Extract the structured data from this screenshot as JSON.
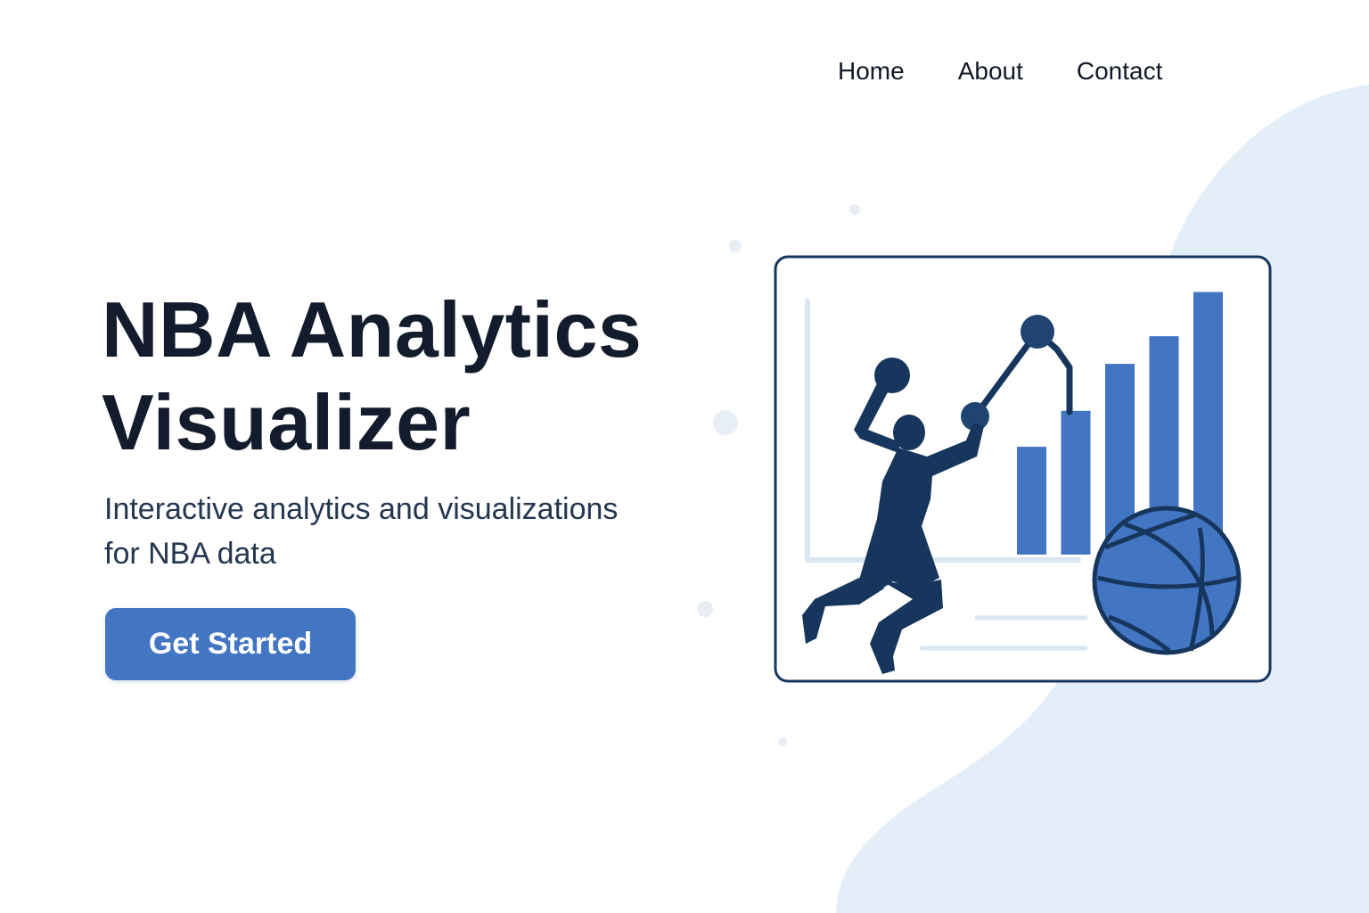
{
  "nav": {
    "items": [
      {
        "label": "Home"
      },
      {
        "label": "About"
      },
      {
        "label": "Contact"
      }
    ]
  },
  "hero": {
    "title_line_1": "NBA Analytics",
    "title_line_2": "Visualizer",
    "subtitle_line_1": "Interactive analytics and visualizations",
    "subtitle_line_2": "for NBA data",
    "cta_label": "Get Started"
  },
  "colors": {
    "background": "#ffffff",
    "blob": "#e4eef9",
    "accent": "#4275c2",
    "navy": "#17365d",
    "title_text": "#131c2c",
    "subtitle_text": "#243650",
    "faint_line": "#dbe6f3"
  },
  "illustration": {
    "icons": [
      "basketball-player-icon",
      "basketball-icon",
      "bar-chart-icon",
      "line-chart-icon"
    ],
    "bar_levels": [
      0.39,
      0.52,
      0.69,
      0.79,
      0.95
    ]
  }
}
